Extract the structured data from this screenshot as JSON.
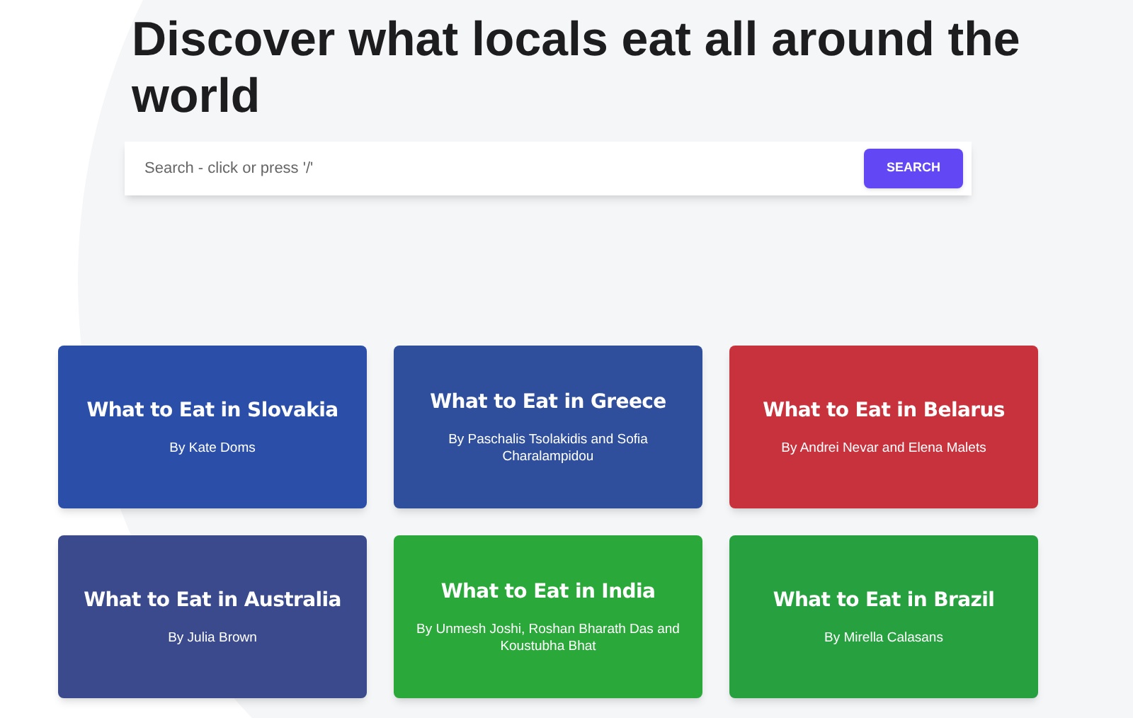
{
  "heading": "Discover what locals eat all around the world",
  "search": {
    "placeholder": "Search - click or press '/'",
    "button": "SEARCH"
  },
  "cards": [
    {
      "title": "What to Eat in Slovakia",
      "byline": "By Kate Doms",
      "color": "#2b4fa8"
    },
    {
      "title": "What to Eat in Greece",
      "byline": "By Paschalis Tsolakidis and Sofia Charalampidou",
      "color": "#2f4f9c"
    },
    {
      "title": "What to Eat in Belarus",
      "byline": "By Andrei Nevar and Elena Malets",
      "color": "#c8323c"
    },
    {
      "title": "What to Eat in Australia",
      "byline": "By Julia Brown",
      "color": "#3a4a8c"
    },
    {
      "title": "What to Eat in India",
      "byline": "By Unmesh Joshi, Roshan Bharath Das and Koustubha Bhat",
      "color": "#2aa83a"
    },
    {
      "title": "What to Eat in Brazil",
      "byline": "By Mirella Calasans",
      "color": "#27a040"
    }
  ]
}
